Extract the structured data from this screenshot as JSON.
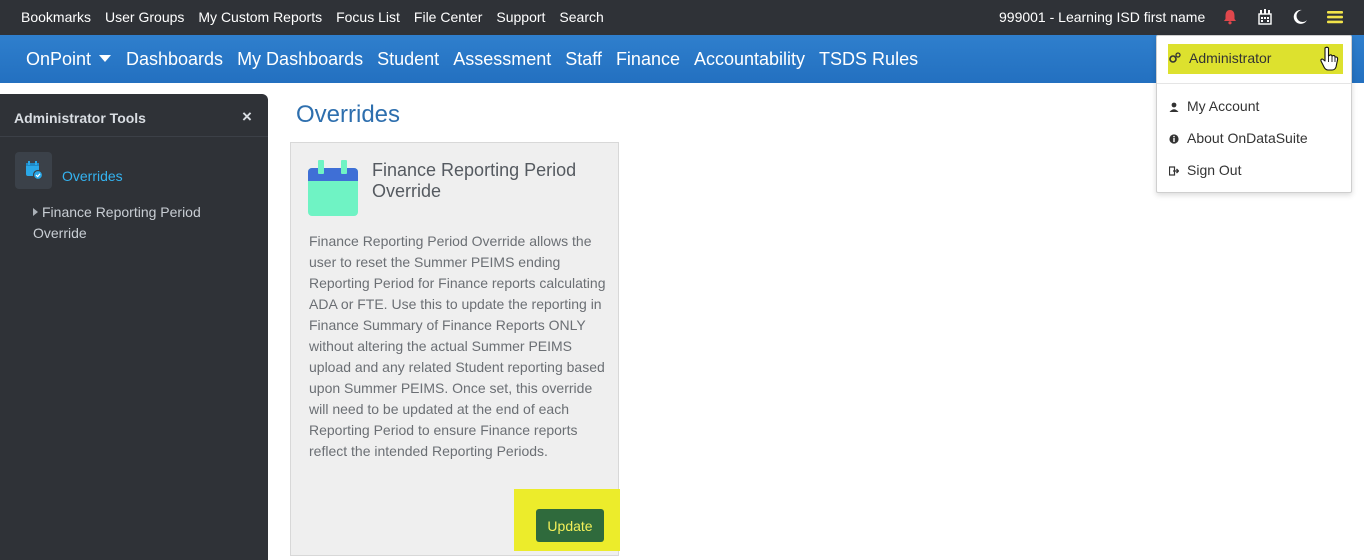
{
  "topbar": {
    "links": [
      "Bookmarks",
      "User Groups",
      "My Custom Reports",
      "Focus List",
      "File Center",
      "Support",
      "Search"
    ],
    "user": "999001 - Learning ISD first name",
    "icons": [
      "bell-icon",
      "building-icon",
      "moon-icon",
      "menu-icon"
    ],
    "bell_color": "#e0474c",
    "menu_color": "#f2e44a"
  },
  "mainnav": {
    "brand": "OnPoint",
    "items": [
      "Dashboards",
      "My Dashboards",
      "Student",
      "Assessment",
      "Staff",
      "Finance",
      "Accountability",
      "TSDS Rules"
    ]
  },
  "sidebar": {
    "title": "Administrator Tools",
    "close": "×",
    "section": "Overrides",
    "sub_item": "Finance Reporting Period Override"
  },
  "page": {
    "title": "Overrides"
  },
  "card": {
    "title": "Finance Reporting Period Override",
    "description": "Finance Reporting Period Override allows the user to reset the Summer PEIMS ending Reporting Period for Finance reports calculating ADA or FTE. Use this to update the reporting in Finance Summary of Finance Reports ONLY without altering the actual Summer PEIMS upload and any related Student reporting based upon Summer PEIMS. Once set, this override will need to be updated at the end of each Reporting Period to ensure Finance reports reflect the intended Reporting Periods.",
    "button": "Update"
  },
  "dropdown": {
    "items": [
      {
        "label": "Administrator",
        "icon": "cogs-icon"
      },
      {
        "label": "My Account",
        "icon": "user-icon"
      },
      {
        "label": "About OnDataSuite",
        "icon": "info-icon"
      },
      {
        "label": "Sign Out",
        "icon": "sign-out-icon"
      }
    ]
  }
}
